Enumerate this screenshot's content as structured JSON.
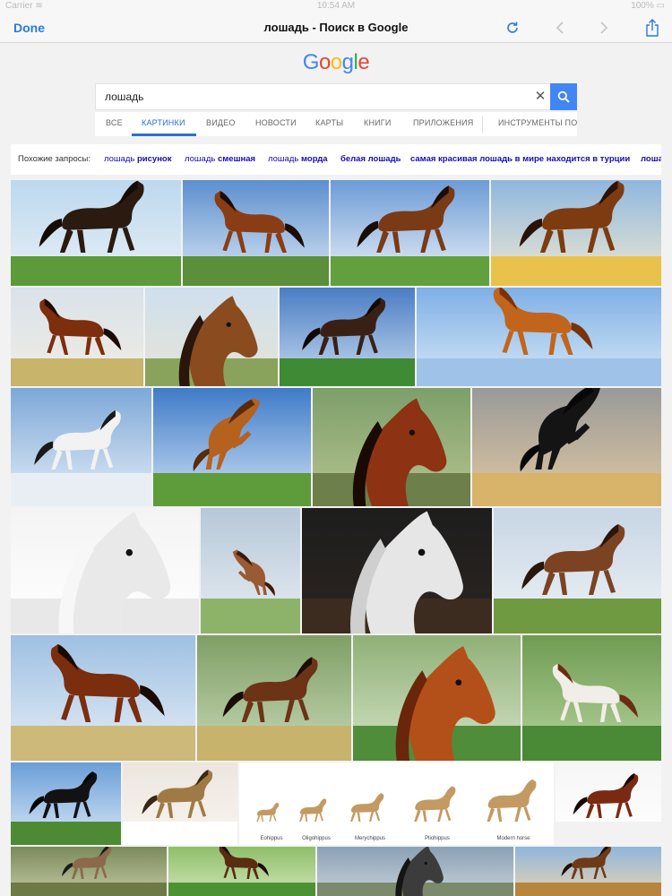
{
  "statusbar": {
    "carrier": "Carrier ≋",
    "time": "10:54 AM",
    "battery": "100% ▭"
  },
  "nav": {
    "done_label": "Done",
    "title": "лошадь - Поиск в Google"
  },
  "icons": {
    "refresh": "refresh-icon",
    "back": "back-arrow-icon",
    "forward": "forward-arrow-icon",
    "share": "share-icon",
    "search": "search-icon",
    "clear": "clear-icon"
  },
  "colors": {
    "accent": "#2a7ad9",
    "google_blue": "#4285f4",
    "google_red": "#ea4335",
    "google_yellow": "#fbbc05",
    "google_green": "#34a853",
    "link": "#1a0dab"
  },
  "google": {
    "logo_letters": [
      "G",
      "o",
      "o",
      "g",
      "l",
      "e"
    ],
    "search_value": "лошадь",
    "clear_symbol": "✕"
  },
  "tabs": [
    "ВСЕ",
    "КАРТИНКИ",
    "ВИДЕО",
    "НОВОСТИ",
    "КАРТЫ",
    "КНИГИ",
    "ПРИЛОЖЕНИЯ",
    "ИНСТРУМЕНТЫ ПО"
  ],
  "active_tab": "КАРТИНКИ",
  "related": {
    "label": "Похожие запросы:",
    "items": [
      {
        "plain": "лошадь ",
        "bold": "рисунок"
      },
      {
        "plain": "лошадь ",
        "bold": "смешная"
      },
      {
        "plain": "лошадь ",
        "bold": "морда"
      },
      {
        "plain": "",
        "bold": "белая лошадь"
      },
      {
        "plain": "",
        "bold": "самая красивая лошадь в мире находится в турции"
      },
      {
        "plain": "",
        "bold": "лоша"
      }
    ]
  },
  "evolution_labels": [
    "Eohippus",
    "Oligohippus",
    "Merychippus",
    "Pliohippus",
    "Modern horse"
  ],
  "image_results": [
    {
      "name": "image-result-1",
      "kind": "dark-horse-running-grass"
    },
    {
      "name": "image-result-2",
      "kind": "bay-horse-trotting-sky"
    },
    {
      "name": "image-result-3",
      "kind": "bay-horse-galloping-clouds"
    },
    {
      "name": "image-result-4",
      "kind": "chestnut-horse-yellow-field"
    },
    {
      "name": "image-result-5",
      "kind": "bay-horse-running"
    },
    {
      "name": "image-result-6",
      "kind": "horse-head-portrait"
    },
    {
      "name": "image-result-7",
      "kind": "dark-horse-trotting"
    },
    {
      "name": "image-result-8",
      "kind": "two-chestnut-horses-jumping"
    },
    {
      "name": "image-result-9",
      "kind": "white-and-black-horses-snow"
    },
    {
      "name": "image-result-10",
      "kind": "chestnut-horse-rearing"
    },
    {
      "name": "image-result-11",
      "kind": "chestnut-horse-head-closeup"
    },
    {
      "name": "image-result-12",
      "kind": "black-horse-rearing"
    },
    {
      "name": "image-result-13",
      "kind": "white-horse-halter"
    },
    {
      "name": "image-result-14",
      "kind": "horse-rearing-meadow"
    },
    {
      "name": "image-result-15",
      "kind": "laughing-white-horse"
    },
    {
      "name": "image-result-16",
      "kind": "draft-horse-pasture"
    },
    {
      "name": "image-result-17",
      "kind": "bay-horse-standing"
    },
    {
      "name": "image-result-18",
      "kind": "bay-horse-galloping-farm"
    },
    {
      "name": "image-result-19",
      "kind": "chestnut-horse-portrait"
    },
    {
      "name": "image-result-20",
      "kind": "pinto-horse-running"
    },
    {
      "name": "image-result-21",
      "kind": "black-horse-sky"
    },
    {
      "name": "image-result-22",
      "kind": "przewalski-horse-snow"
    },
    {
      "name": "image-result-23",
      "kind": "horse-evolution-chart"
    },
    {
      "name": "image-result-24",
      "kind": "chestnut-horse-studio"
    },
    {
      "name": "image-result-25",
      "kind": "horse-with-dog"
    },
    {
      "name": "image-result-26",
      "kind": "bay-horse-green-field"
    },
    {
      "name": "image-result-27",
      "kind": "grey-horse-portrait"
    },
    {
      "name": "image-result-28",
      "kind": "horses-desert-landscape"
    }
  ]
}
